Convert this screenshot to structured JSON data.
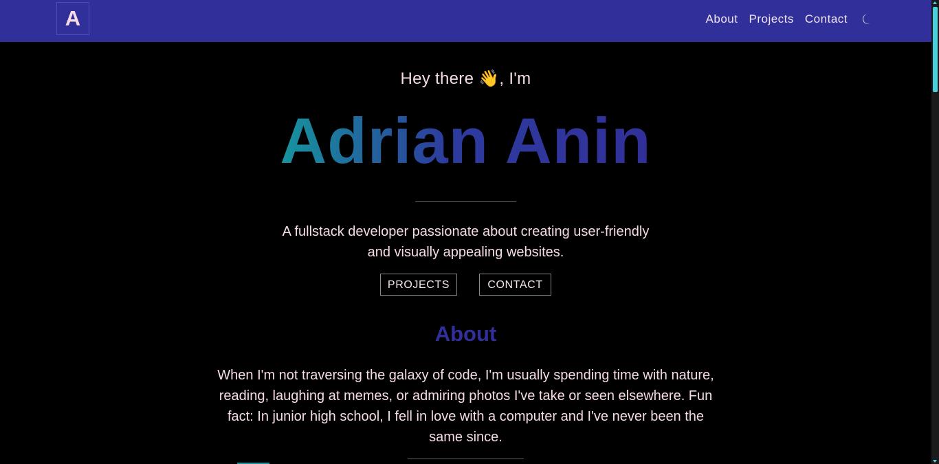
{
  "navbar": {
    "logo_letter": "A",
    "links": [
      {
        "label": "About"
      },
      {
        "label": "Projects"
      },
      {
        "label": "Contact"
      }
    ],
    "theme_toggle_icon": "moon-icon"
  },
  "hero": {
    "greeting": "Hey there 👋, I'm",
    "name": "Adrian Anin",
    "tagline_line1": "A fullstack developer passionate about creating user-friendly",
    "tagline_line2": "and visually appealing websites.",
    "buttons": {
      "projects": "PROJECTS",
      "contact": "CONTACT"
    }
  },
  "about": {
    "heading": "About",
    "text": "When I'm not traversing the galaxy of code, I'm usually spending time with nature, reading, laughing at memes, or admiring photos I've take or seen elsewhere. Fun fact: In junior high school, I fell in love with a computer and I've never been the same since."
  },
  "colors": {
    "navbar_bg": "#31309a",
    "background": "#000000",
    "text": "#f6dbe4",
    "gradient_start": "#16959e",
    "gradient_end": "#31309a",
    "accent": "#4bcfd8"
  }
}
